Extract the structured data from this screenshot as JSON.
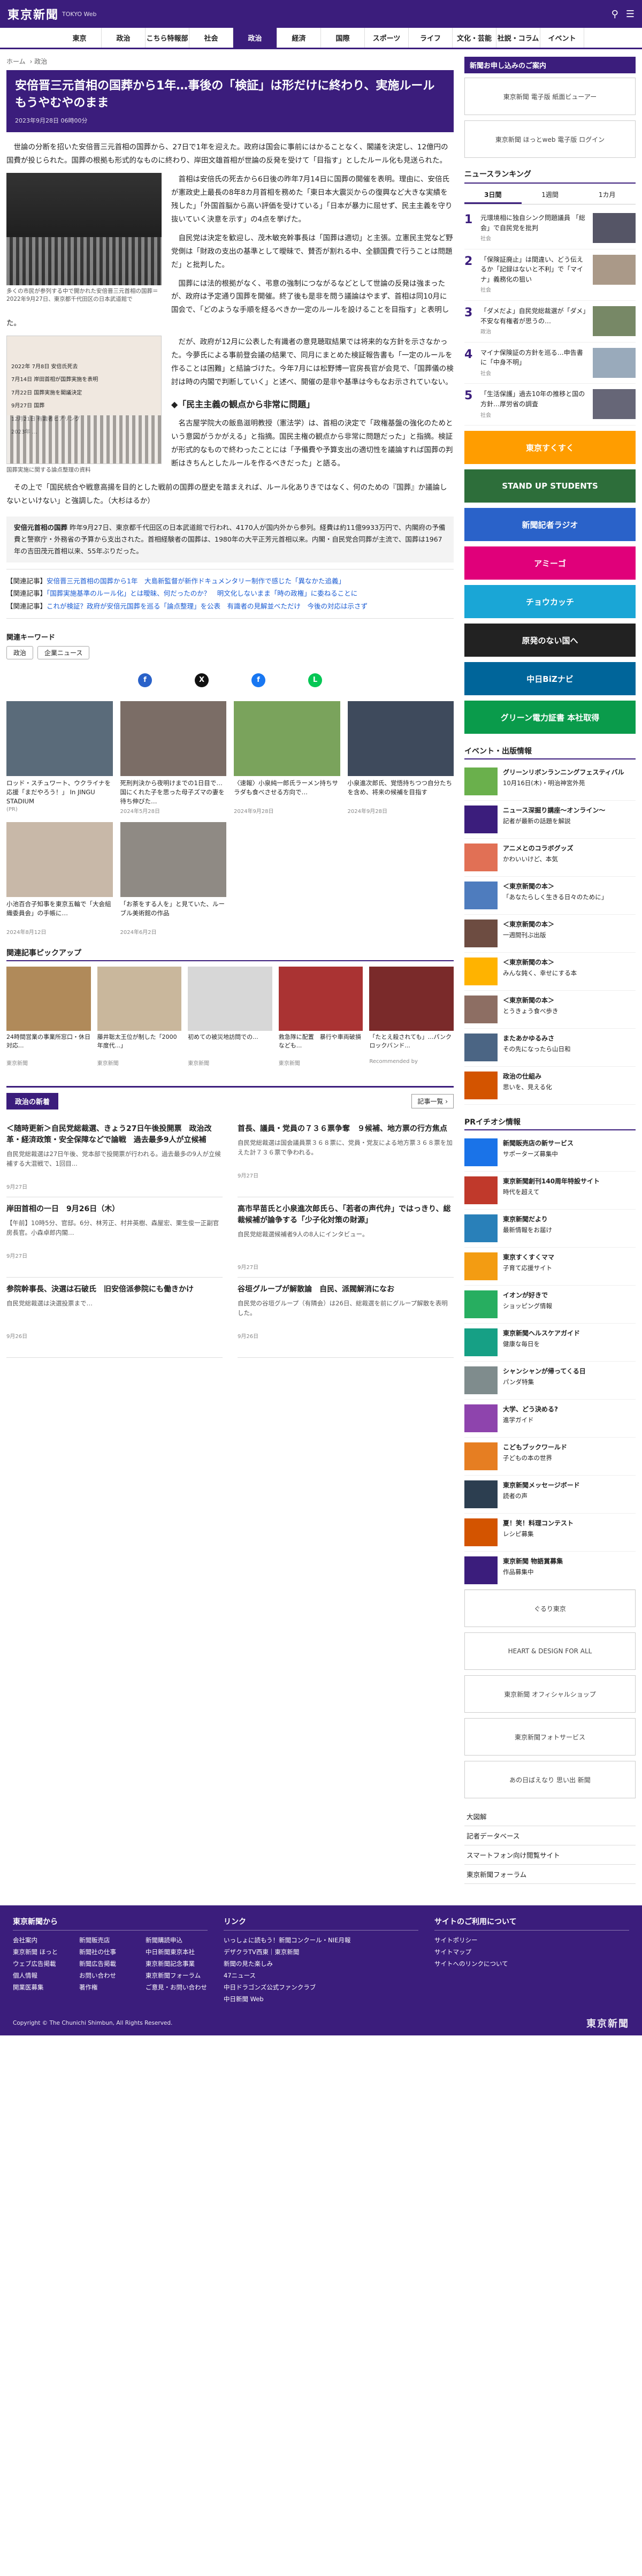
{
  "header": {
    "logo": "東京新聞",
    "logo_sub": "TOKYO Web"
  },
  "nav": [
    "東京",
    "政治",
    "国際",
    "こちら特報部",
    "社会",
    "政治",
    "経済",
    "国際",
    "スポーツ",
    "ライフ",
    "文化・芸能",
    "社説・コラム",
    "イベント"
  ],
  "breadcrumb": [
    "ホーム",
    "政治"
  ],
  "article": {
    "title": "安倍晋三元首相の国葬から1年…事後の「検証」は形だけに終わり、実施ルールもうやむやのまま",
    "date": "2023年9月28日 06時00分",
    "lead": "世論の分断を招いた安倍晋三元首相の国葬から、27日で1年を迎えた。政府は国会に事前にはかることなく、閣議を決定し、12億円の国費が投じられた。国葬の根拠も形式的なものに終わり、岸田文雄首相が世論の反発を受けて「目指す」としたルール化も見送られた。",
    "fig1_caption": "多くの市民が参列する中で開かれた安倍晋三元首相の国葬＝2022年9月27日、東京都千代田区の日本武道館で",
    "p1": "首相は安倍氏の死去から6日後の昨年7月14日に国葬の開催を表明。理由に、安倍氏が憲政史上最長の8年8カ月首相を務めた「東日本大震災からの復興など大きな実績を残した」「外国首脳から高い評価を受けている」「日本が暴力に屈せず、民主主義を守り抜いていく決意を示す」の4点を挙げた。",
    "p2": "自民党は決定を歓迎し、茂木敏充幹事長は「国葬は適切」と主張。立憲民主党など野党側は「財政の支出の基準として曖昧で、賛否が割れる中、全額国費で行うことは問題だ」と批判した。",
    "p3": "国葬には法的根拠がなく、弔意の強制につながるなどとして世論の反発は強まったが、政府は予定通り国葬を開催。終了後も是非を問う議論はやまず、首相は同10月に国会で、「どのような手順を経るべきか一定のルールを設けることを目指す」と表明した。",
    "fig2_caption": "国葬実施に関する論点整理の資料",
    "fig2_lines": [
      "2022年 7月8日 安倍氏死去",
      "7月14日 岸田首相が国葬実施を表明",
      "7月22日 国葬実施を閣議決定",
      "9月27日 国葬",
      "12月21日 有識者ヒアリング",
      "2023年 …"
    ],
    "p4": "だが、政府が12月に公表した有識者の意見聴取結果では将来的な方針を示さなかった。今夢氏による事前登会議の結果で、同月にまとめた検証報告書も「一定のルールを作ることは困難」と結論づけた。今年7月には松野博一官房長官が会見で、「国葬儀の検討は時の内閣で判断していく」と述べ、開催の是非や基準は今もなお示されていない。",
    "subhead": "◆「民主主義の観点から非常に問題」",
    "p5": "名古屋学院大の飯島滋明教授（憲法学）は、首相の決定で「政権基盤の強化のためという意図がうかがえる」と指摘。国民主権の観点から非常に問題だった」と指摘。検証が形式的なもので終わったことには「予備費や予算支出の適切性を議論すれば国葬の判断はきちんとしたルールを作るべきだった」と語る。",
    "p6": "その上で「国民統合や戦意高揚を目的とした戦前の国葬の歴史を踏まえれば、ルール化ありきではなく、何のための『国葬』か議論しないといけない」と強調した。（大杉はるか）",
    "note_title": "安倍元首相の国葬",
    "note": "昨年9月27日、東京都千代田区の日本武道館で行われ、4170人が国内外から参列。経費は約11億9933万円で、内閣府の予備費と警察庁・外務省の予算から支出された。首相経験者の国葬は、1980年の大平正芳元首相以来。内閣・自民党合同葬が主流で、国葬は1967年の吉田茂元首相以来、55年ぶりだった。",
    "related": [
      {
        "tag": "【関連記事】",
        "text": "安倍晋三元首相の国葬から1年　大島新監督が新作ドキュメンタリー制作で感じた「異なかた追義」"
      },
      {
        "tag": "【関連記事】",
        "text": "「国葬実施基準のルール化」とは曖昧、何だったのか？　明文化しないまま「時の政権」に委ねることに"
      },
      {
        "tag": "【関連記事】",
        "text": "これが検証？政府が安倍元国葬を巡る「論点整理」を公表　有識者の見解並べただけ　今後の対応は示さず"
      }
    ]
  },
  "keywords": {
    "title": "関連キーワード",
    "items": [
      "政治",
      "企業ニュース"
    ]
  },
  "cards": [
    {
      "t": "ロッド・スチュワート、ウクライナを応援「まだやろう！」 In JINGU STADIUM",
      "d": "(PR)"
    },
    {
      "t": "死刑判決から夜明けまでの1日目で…国にくれた子を思った母子ズマの妻を待ち伸びた…",
      "d": "2024年5月28日"
    },
    {
      "t": "〈速報〉小泉純一郎氏ラーメン持ちサラダも食べさせる方向で…",
      "d": "2024年9月28日"
    },
    {
      "t": "小泉進次郎氏、覚悟持ちつつ自分たちを含め、将来の候補を目指す",
      "d": "2024年9月28日"
    },
    {
      "t": "小池百合子知事を東京五輪で「大会組織委員会」の手帳に…",
      "d": "2024年8月12日"
    },
    {
      "t": "「お茶をする人を」と見ていた、ルーブル美術館の作品",
      "d": "2024年6月2日"
    }
  ],
  "pickup": {
    "title": "関連記事ピックアップ",
    "items": [
      {
        "t": "24時間営業の事業所窓口・休日対応...",
        "s": "東京新聞"
      },
      {
        "t": "藤井聡太王位が制した「2000年度代...」",
        "s": "東京新聞"
      },
      {
        "t": "初めての被災地訪問での...",
        "s": "東京新聞"
      },
      {
        "t": "救急隊に配置　暴行や車両破損なども...",
        "s": "東京新聞"
      },
      {
        "t": "「たとえ殺されても」…パンクロックバンド...",
        "s": "Recommended by"
      }
    ]
  },
  "politics": {
    "label": "政治の新着",
    "more": "記事一覧 ›",
    "items": [
      {
        "h": "＜随時更新＞自民党総裁選、きょう27日午後投開票　政治改革・経済政策・安全保障などで論戦　過去最多9人が立候補",
        "p": "自民党総裁選は27日午後、党本部で投開票が行われる。過去最多の9人が立候補する大混戦で、1回目...",
        "d": "9月27日"
      },
      {
        "h": "首長、議員・党員の７３６票争奪　９候補、地方票の行方焦点",
        "p": "自民党総裁選は国会議員票３６８票に、党員・党友による地方票３６８票を加えた計７３６票で争われる。",
        "d": "9月27日"
      },
      {
        "h": "岸田首相の一日　9月26日（木）",
        "p": "【午前】10時5分、官邸。6分、林芳正、村井英樹、森屋宏、栗生俊一正副官房長官。小森卓郎内閣…",
        "d": "9月27日"
      },
      {
        "h": "高市早苗氏と小泉進次郎氏ら、「若者の声代弁」ではっきり、総裁候補が論争する「少子化対策の財源」",
        "p": "自民党総裁選候補者9人の8人にインタビュー。",
        "d": "9月27日"
      },
      {
        "h": "参院幹事長、決選は石破氏　旧安倍派参院にも働きかけ",
        "p": "自民党総裁選は決選投票まで…",
        "d": "9月26日"
      },
      {
        "h": "谷垣グループが解散論　自民、派閥解消になお",
        "p": "自民党の谷垣グループ（有隣会）は26日、総裁選を前にグループ解散を表明した。",
        "d": "9月26日"
      }
    ]
  },
  "side": {
    "promo_head": "新聞お申し込みのご案内",
    "promo1": "東京新聞 電子版 紙面ビューアー",
    "promo2": "東京新聞 ほっとweb 電子版 ログイン",
    "ranking_head": "ニュースランキング",
    "tabs": [
      "3日間",
      "1週間",
      "1カ月"
    ],
    "ranking": [
      {
        "n": "1",
        "t": "元環境相に独自シンク問題議員 「総会」で自民党を批判",
        "cat": "社会"
      },
      {
        "n": "2",
        "t": "「保険証廃止」は間違い、どう伝えるか「記録はないと不利」で「マイナ」義務化の狙い",
        "cat": "社会"
      },
      {
        "n": "3",
        "t": "「ダメだよ」自民党総裁選が「ダメ」不安な有権者が思うの…",
        "cat": "政治"
      },
      {
        "n": "4",
        "t": "マイナ保険証の方針を巡る…申告書に「中身不明」",
        "cat": "社会"
      },
      {
        "n": "5",
        "t": "「生活保護」過去10年の推移と国の方針…厚労省の調査",
        "cat": "社会"
      }
    ],
    "banners": [
      {
        "label": "東京すくすく",
        "color": "#ff9d00"
      },
      {
        "label": "STAND UP STUDENTS",
        "color": "#2d6e3a"
      },
      {
        "label": "新聞記者ラジオ",
        "color": "#2a62c9"
      },
      {
        "label": "アミーゴ",
        "color": "#e0007a"
      },
      {
        "label": "チョウカッチ",
        "color": "#1aa6d6"
      },
      {
        "label": "原発のない国へ",
        "color": "#222222"
      },
      {
        "label": "中日BiZナビ",
        "color": "#00659a"
      },
      {
        "label": "グリーン電力証書 本社取得",
        "color": "#0a9b4b"
      }
    ],
    "events_head": "イベント・出版情報",
    "events": [
      {
        "b": "グリーンリボンランニングフェスティバル",
        "t": "10月16日(木)・明治神宮外苑",
        "c": "#6ab04c"
      },
      {
        "b": "ニュース深掘り講座〜オンライン〜",
        "t": "記者が最新の話題を解説",
        "c": "#3b1d7c"
      },
      {
        "b": "アニメとのコラボグッズ",
        "t": "かわいいけど、本気",
        "c": "#e17055"
      },
      {
        "b": "＜東京新聞の本＞",
        "t": "「あなたらしく生きる日々のために」",
        "c": "#4e7cbe"
      },
      {
        "b": "＜東京新聞の本＞",
        "t": "一週間刊ぶ出版",
        "c": "#6d4c41"
      },
      {
        "b": "＜東京新聞の本＞",
        "t": "みんな鈍く、幸せにする本",
        "c": "#ffb300"
      },
      {
        "b": "＜東京新聞の本＞",
        "t": "とうきょう食べ歩き",
        "c": "#8d6e63"
      },
      {
        "b": "またあかゆるみさ",
        "t": "その先になったら山日和",
        "c": "#4b6584"
      },
      {
        "b": "政治の仕組み",
        "t": "思いを、見える化",
        "c": "#d35400"
      }
    ],
    "pr_head": "PRイチオシ情報",
    "pr": [
      {
        "b": "新聞販売店の新サービス",
        "t": "サポーターズ募集中",
        "c": "#1a73e8"
      },
      {
        "b": "東京新聞創刊140周年特設サイト",
        "t": "時代を超えて",
        "c": "#c0392b"
      },
      {
        "b": "東京新聞だより",
        "t": "最新情報をお届け",
        "c": "#2980b9"
      },
      {
        "b": "東京すくすくママ",
        "t": "子育て応援サイト",
        "c": "#f39c12"
      },
      {
        "b": "イオンが好きで",
        "t": "ショッピング情報",
        "c": "#27ae60"
      },
      {
        "b": "東京新聞ヘルスケアガイド",
        "t": "健康な毎日を",
        "c": "#16a085"
      },
      {
        "b": "シャンシャンが帰ってくる日",
        "t": "パンダ特集",
        "c": "#7f8c8d"
      },
      {
        "b": "大学、どう決める?",
        "t": "進学ガイド",
        "c": "#8e44ad"
      },
      {
        "b": "こどもブックワールド",
        "t": "子どもの本の世界",
        "c": "#e67e22"
      },
      {
        "b": "東京新聞メッセージボード",
        "t": "読者の声",
        "c": "#2c3e50"
      },
      {
        "b": "夏！笑！料理コンテスト",
        "t": "レシピ募集",
        "c": "#d35400"
      },
      {
        "b": "東京新聞 物語賞募集",
        "t": "作品募集中",
        "c": "#3b1d7c"
      }
    ],
    "ads2": [
      "ぐるり東京",
      "HEART & DESIGN FOR ALL",
      "東京新聞 オフィシャルショップ",
      "東京新聞フォトサービス",
      "あの日ばえなり 思い出 新聞"
    ],
    "links": [
      "大図解",
      "記者データベース",
      "スマートフォン向け閲覧サイト",
      "東京新聞フォーラム"
    ]
  },
  "footer": {
    "col1_title": "東京新聞から",
    "col1": [
      "会社案内",
      "新聞販売店",
      "新聞購読申込",
      "東京新聞 ほっと",
      "新聞社の仕事",
      "中日新聞東京本社",
      "ウェブ広告掲載",
      "新聞広告掲載",
      "東京新聞記念事業",
      "個人情報",
      "お問い合わせ",
      "東京新聞フォーラム",
      "開業医募集",
      "著作権",
      "ご意見・お問い合わせ"
    ],
    "col2_title": "リンク",
    "col2": [
      "いっしょに読もう！新聞コンクール・NIE月報",
      "デザクラTV西東｜東京新聞",
      "新聞の見た楽しみ",
      "47ニュース",
      "中日ドラゴンズ公式ファンクラブ",
      "中日新聞 Web"
    ],
    "col3_title": "サイトのご利用について",
    "col3": [
      "サイトポリシー",
      "サイトマップ",
      "サイトへのリンクについて"
    ],
    "copyright": "Copyright © The Chunichi Shimbun, All Rights Reserved."
  }
}
